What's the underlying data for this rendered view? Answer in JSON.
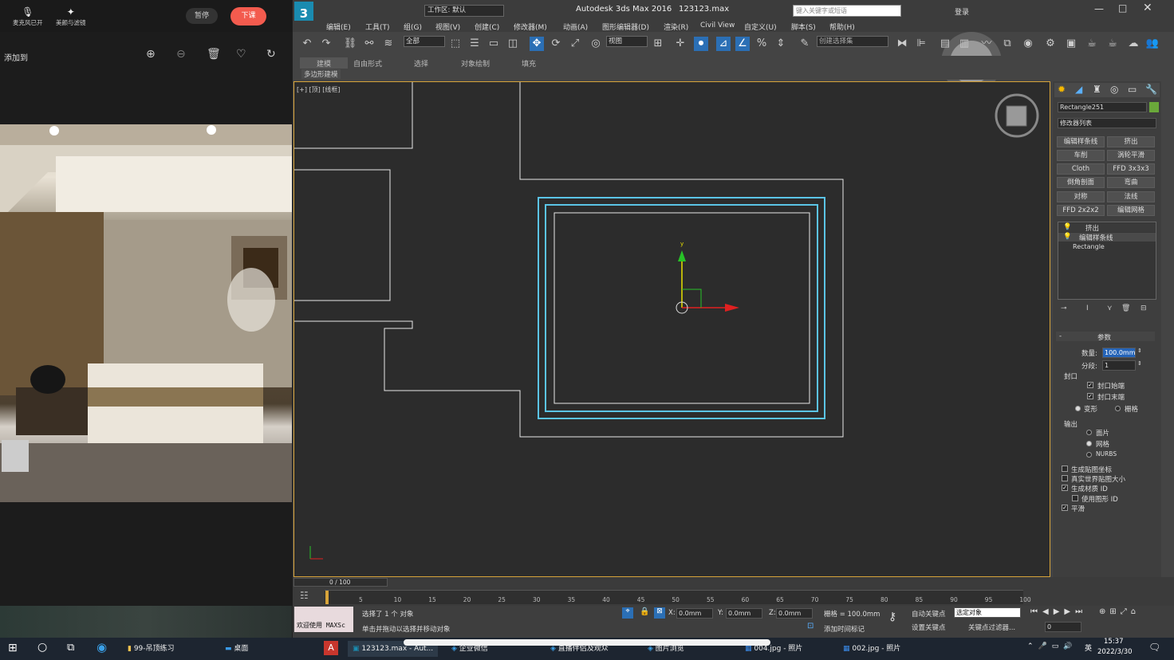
{
  "left_panel": {
    "mic_label": "麦克风已开",
    "beauty_label": "美颜与滤镜",
    "pause_label": "暂停",
    "end_class_label": "下课",
    "add_to_label": "添加到"
  },
  "max_window": {
    "app_title": "Autodesk 3ds Max 2016",
    "file_name": "123123.max",
    "workspace": "工作区: 默认",
    "search_placeholder": "键入关键字或短语",
    "login_label": "登录",
    "menu": [
      "编辑(E)",
      "工具(T)",
      "组(G)",
      "视图(V)",
      "创建(C)",
      "修改器(M)",
      "动画(A)",
      "图形编辑器(D)",
      "渲染(R)",
      "Civil View",
      "自定义(U)",
      "脚本(S)",
      "帮助(H)"
    ],
    "toolbar": {
      "filter_select": "全部",
      "view_select": "视图",
      "selection_set": "创建选择集"
    },
    "ribbon_tabs": [
      "建模",
      "自由形式",
      "选择",
      "对象绘制",
      "填充"
    ],
    "ribbon_sub": "多边形建模",
    "viewport_label": "[+] [顶] [线框]",
    "accent": "#5bc4e6"
  },
  "command_panel": {
    "object_name": "Rectangle251",
    "modifier_list": "修改器列表",
    "modifier_buttons": [
      "编辑样条线",
      "挤出",
      "车削",
      "涡轮平滑",
      "Cloth",
      "FFD 3x3x3",
      "倒角剖面",
      "弯曲",
      "对称",
      "法线",
      "FFD 2x2x2",
      "编辑网格"
    ],
    "stack": [
      "挤出",
      "编辑样条线",
      "Rectangle"
    ],
    "params_title": "参数",
    "amount_label": "数量:",
    "amount_value": "100.0mm",
    "segments_label": "分段:",
    "segments_value": "1",
    "capping_title": "封口",
    "cap_start": "封口始端",
    "cap_end": "封口末端",
    "morph": "变形",
    "grid": "栅格",
    "output_title": "输出",
    "patch": "面片",
    "mesh": "网格",
    "nurbs": "NURBS",
    "gen_map": "生成贴图坐标",
    "real_world": "真实世界贴图大小",
    "gen_mat": "生成材质 ID",
    "use_shape": "使用图形 ID",
    "smooth": "平滑"
  },
  "timeline": {
    "frame": "0 / 100",
    "ticks": [
      "5",
      "10",
      "15",
      "20",
      "25",
      "30",
      "35",
      "40",
      "45",
      "50",
      "55",
      "60",
      "65",
      "70",
      "75",
      "80",
      "85",
      "90",
      "95",
      "100"
    ]
  },
  "status": {
    "welcome": "欢迎使用 MAXSc",
    "selected": "选择了 1 个 对象",
    "hint": "单击并拖动以选择并移动对象",
    "x": "0.0mm",
    "y": "0.0mm",
    "z": "0.0mm",
    "grid": "栅格 = 100.0mm",
    "auto_key": "自动关键点",
    "set_key": "设置关键点",
    "key_select": "选定对象",
    "add_time_tag": "添加时间标记",
    "key_filter": "关键点过滤器...",
    "frame_field": "0"
  },
  "taskbar": {
    "items": [
      "99-吊顶练习",
      "桌面",
      "123123.max - Aut...",
      "企业微信",
      "直播伴侣及观众",
      "图片浏览",
      "004.jpg - 照片",
      "002.jpg - 照片"
    ],
    "time": "15:37",
    "date": "2022/3/30",
    "lang": "英"
  }
}
